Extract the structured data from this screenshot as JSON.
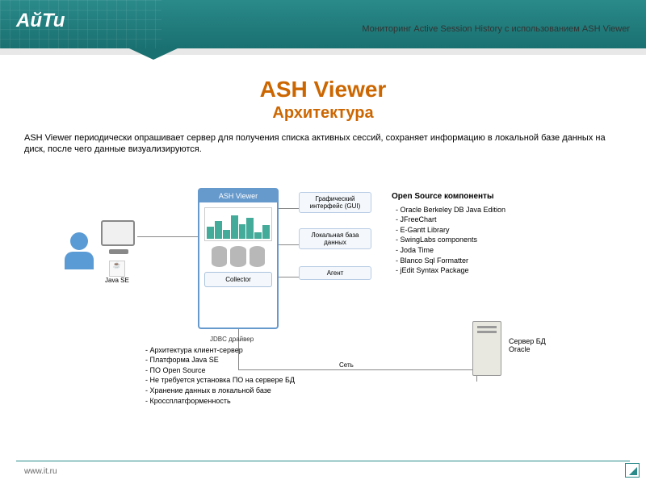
{
  "header": {
    "logo": "АйТи",
    "title": "Мониторинг Active Session History с использованием ASH Viewer"
  },
  "main": {
    "title": "ASH Viewer",
    "subtitle": "Архитектура",
    "description": "ASH Viewer периодически опрашивает сервер для получения списка активных сессий, сохраняет информацию в локальной базе данных на диск, после чего данные визуализируются."
  },
  "diagram": {
    "java_label": "Java SE",
    "ash_viewer_title": "ASH Viewer",
    "collector_label": "Collector",
    "jdbc_label": "JDBC драйвер",
    "gui_label": "Графический интерфейс (GUI)",
    "localdb_label": "Локальная база данных",
    "agent_label": "Агент",
    "network_label": "Сеть",
    "server_label_1": "Сервер БД",
    "server_label_2": "Oracle"
  },
  "opensource": {
    "title": "Open Source компоненты",
    "items": [
      "- Oracle Berkeley DB Java Edition",
      "- JFreeChart",
      "- E-Gantt Library",
      "- SwingLabs components",
      "- Joda Time",
      "- Blanco Sql Formatter",
      "- jEdit Syntax Package"
    ]
  },
  "architecture": {
    "items": [
      "- Архитектура клиент-сервер",
      "- Платформа Java SE",
      "- ПО Open Source",
      "- Не требуется установка ПО на сервере БД",
      "- Хранение данных в локальной базе",
      "- Кроссплатформенность"
    ]
  },
  "footer": {
    "url": "www.it.ru"
  }
}
